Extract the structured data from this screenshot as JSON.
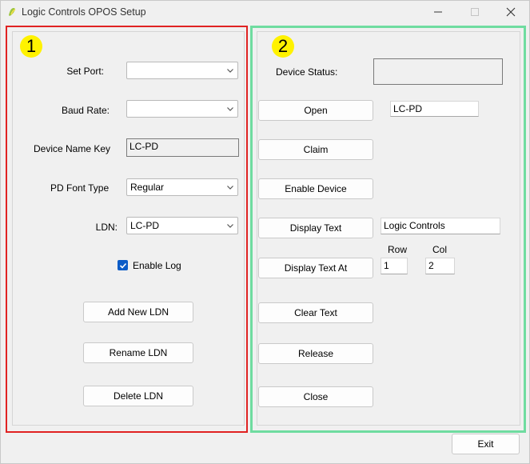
{
  "window": {
    "title": "Logic Controls OPOS Setup",
    "controls": {
      "minimize": "minimize-icon",
      "maximize": "maximize-icon",
      "close": "close-icon"
    }
  },
  "colors": {
    "badge": "#fff200",
    "left_frame": "#e02222",
    "right_frame": "#6fdca0",
    "checkbox": "#0b5cc7"
  },
  "left": {
    "badge": "1",
    "set_port": {
      "label": "Set Port:",
      "value": ""
    },
    "baud_rate": {
      "label": "Baud Rate:",
      "value": ""
    },
    "device_name_key": {
      "label": "Device Name Key",
      "value": "LC-PD"
    },
    "pd_font_type": {
      "label": "PD Font Type",
      "value": "Regular"
    },
    "ldn": {
      "label": "LDN:",
      "value": "LC-PD"
    },
    "enable_log": {
      "label": "Enable Log",
      "checked": true
    },
    "buttons": {
      "add": "Add New LDN",
      "rename": "Rename LDN",
      "delete": "Delete LDN"
    }
  },
  "right": {
    "badge": "2",
    "device_status": {
      "label": "Device Status:",
      "value": ""
    },
    "open": {
      "label": "Open",
      "value": "LC-PD"
    },
    "claim": "Claim",
    "enable_device": "Enable Device",
    "display_text": {
      "label": "Display Text",
      "value": "Logic Controls"
    },
    "display_text_at": {
      "label": "Display Text At",
      "row_label": "Row",
      "col_label": "Col",
      "row": "1",
      "col": "2"
    },
    "clear_text": "Clear Text",
    "release": "Release",
    "close": "Close"
  },
  "footer": {
    "exit": "Exit"
  }
}
